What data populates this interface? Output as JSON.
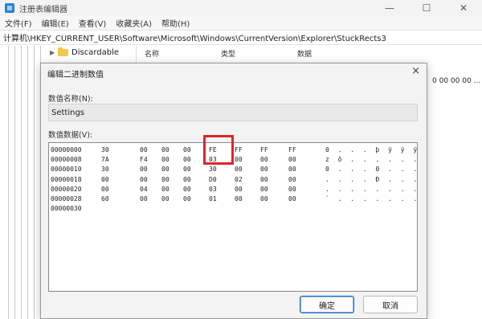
{
  "window": {
    "title": "注册表编辑器",
    "controls": {
      "minimize": "—",
      "maximize": "☐",
      "close": "✕"
    }
  },
  "menu": [
    "文件(F)",
    "编辑(E)",
    "查看(V)",
    "收藏夹(A)",
    "帮助(H)"
  ],
  "address": "计算机\\HKEY_CURRENT_USER\\Software\\Microsoft\\Windows\\CurrentVersion\\Explorer\\StuckRects3",
  "tree": {
    "node_label": "Discardable"
  },
  "list": {
    "columns": [
      "名称",
      "类型",
      "数据"
    ],
    "visible_value": "0 00 00 00 ..."
  },
  "dialog": {
    "title": "编辑二进制数值",
    "close": "×",
    "name_label": "数值名称(N):",
    "name_value": "Settings",
    "data_label": "数值数据(V):",
    "rows": [
      {
        "addr": "00000000",
        "bytes": [
          "30",
          "00",
          "00",
          "00",
          "FE",
          "FF",
          "FF",
          "FF"
        ],
        "ascii": "0 . . . þ ÿ ÿ ÿ"
      },
      {
        "addr": "00000008",
        "bytes": [
          "7A",
          "F4",
          "00",
          "00",
          "03",
          "00",
          "00",
          "00"
        ],
        "ascii": "z ô . . . . . ."
      },
      {
        "addr": "00000010",
        "bytes": [
          "30",
          "00",
          "00",
          "00",
          "30",
          "00",
          "00",
          "00"
        ],
        "ascii": "0 . . . 0 . . ."
      },
      {
        "addr": "00000018",
        "bytes": [
          "00",
          "00",
          "00",
          "00",
          "D0",
          "02",
          "00",
          "00"
        ],
        "ascii": ". . . . Ð . . ."
      },
      {
        "addr": "00000020",
        "bytes": [
          "00",
          "04",
          "00",
          "00",
          "03",
          "00",
          "00",
          "00"
        ],
        "ascii": ". . . . . . . ."
      },
      {
        "addr": "00000028",
        "bytes": [
          "60",
          "00",
          "00",
          "00",
          "01",
          "00",
          "00",
          "00"
        ],
        "ascii": "` . . . . . . ."
      },
      {
        "addr": "00000030",
        "bytes": [],
        "ascii": ""
      }
    ],
    "ok_label": "确定",
    "cancel_label": "取消",
    "highlight_color": "#e0242a"
  }
}
